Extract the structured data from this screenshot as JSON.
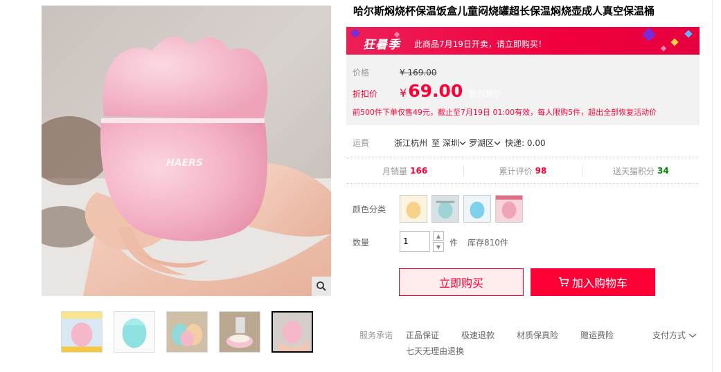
{
  "product": {
    "title": "哈尔斯焖烧杯保温饭盒儿童闷烧罐超长保温焖烧壶成人真空保温桶"
  },
  "promo": {
    "logo": "狂暑季",
    "text": "此商品7月19日开卖，请立即购买！"
  },
  "price": {
    "label": "价格",
    "currency": "¥",
    "original": "169.00",
    "discount_label": "折扣价",
    "discount": "69.00",
    "discount_note": "聚划算价",
    "promo_note": "前500件下单仅售49元，截止至7月19日 01:00有效，每人限购5件，超出全部恢复活动价"
  },
  "shipping": {
    "label": "运费",
    "from": "浙江杭州",
    "to_label": "至",
    "city": "深圳",
    "district": "罗湖区",
    "express": "快递: 0.00"
  },
  "stats": [
    {
      "label": "月销量",
      "value": "166",
      "color": "red"
    },
    {
      "label": "累计评价",
      "value": "98",
      "color": "red"
    },
    {
      "label": "送天猫积分",
      "value": "34",
      "color": "green"
    }
  ],
  "options": {
    "color_label": "颜色分类",
    "qty_label": "数量",
    "qty_value": "1",
    "qty_unit": "件",
    "stock": "库存810件"
  },
  "actions": {
    "buy_now": "立即购买",
    "add_cart": "加入购物车"
  },
  "service": {
    "label": "服务承诺",
    "items": [
      "正品保证",
      "极速退款",
      "材质保真险",
      "赠运费险"
    ],
    "extra": "七天无理由退换",
    "pay": "支付方式"
  },
  "colors": {
    "accent": "#ff0036",
    "banner": "#ec1f57",
    "product_pink": "#f4b8c9"
  },
  "image": {
    "brand": "HAERS"
  }
}
